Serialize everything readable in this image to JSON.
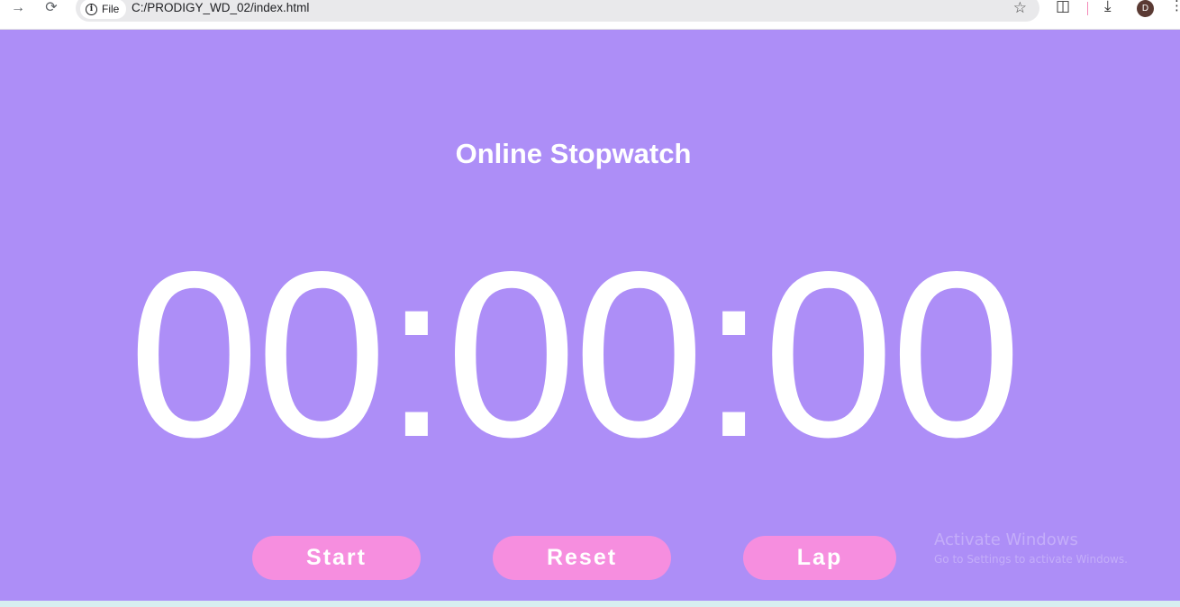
{
  "browser": {
    "back_icon": "arrow-right-icon",
    "reload_icon": "reload-icon",
    "site_chip_label": "File",
    "url": "C:/PRODIGY_WD_02/index.html",
    "avatar_letter": "D"
  },
  "page": {
    "background": "#ad8ef7",
    "title": "Online Stopwatch",
    "time": "00:00:00"
  },
  "controls": {
    "button_color": "#f68edf",
    "start_label": "Start",
    "reset_label": "Reset",
    "lap_label": "Lap"
  },
  "watermark": {
    "title": "Activate Windows",
    "subtitle": "Go to Settings to activate Windows."
  }
}
